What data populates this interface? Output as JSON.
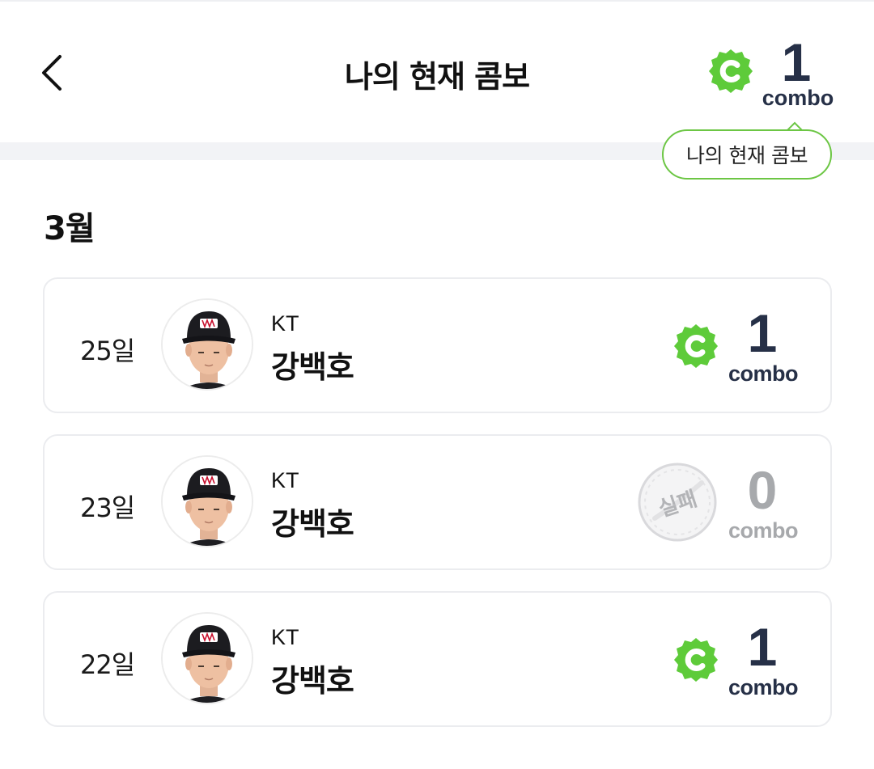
{
  "header": {
    "title": "나의 현재 콤보",
    "current_combo": {
      "value": "1",
      "unit": "combo",
      "icon": "combo-c-badge-icon"
    },
    "back_icon": "chevron-left-icon"
  },
  "tooltip": {
    "text": "나의 현재 콤보"
  },
  "month_label": "3월",
  "entries": [
    {
      "day": "25일",
      "team": "KT",
      "player": "강백호",
      "result": "success",
      "combo": "1",
      "unit": "combo",
      "icon": "combo-c-badge-icon"
    },
    {
      "day": "23일",
      "team": "KT",
      "player": "강백호",
      "result": "fail",
      "fail_label": "실패",
      "combo": "0",
      "unit": "combo",
      "icon": "fail-stamp-icon"
    },
    {
      "day": "22일",
      "team": "KT",
      "player": "강백호",
      "result": "success",
      "combo": "1",
      "unit": "combo",
      "icon": "combo-c-badge-icon"
    }
  ],
  "colors": {
    "accent_green": "#5ecb3a",
    "combo_text": "#263047",
    "fail_gray": "#a7a9ac",
    "divider": "#f2f3f6",
    "card_border": "#ebecef"
  }
}
